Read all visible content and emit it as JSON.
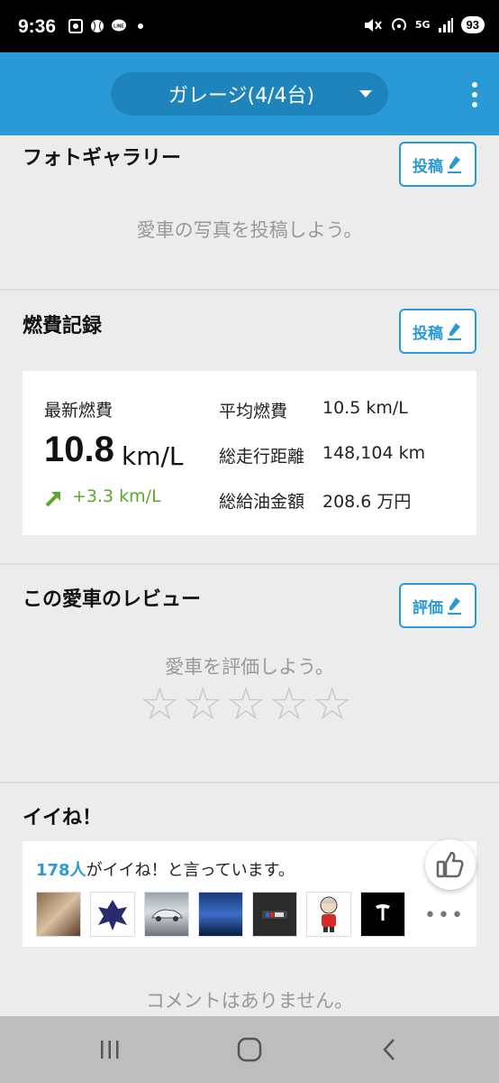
{
  "status": {
    "time": "9:36",
    "battery": "93",
    "network": "5G"
  },
  "app_bar": {
    "garage_label": "ガレージ(4/4台)"
  },
  "photo_gallery": {
    "title": "フォトギャラリー",
    "post_label": "投稿",
    "empty_text": "愛車の写真を投稿しよう。"
  },
  "fuel": {
    "title": "燃費記録",
    "post_label": "投稿",
    "latest_label": "最新燃費",
    "latest_value": "10.8",
    "latest_unit": "km/L",
    "diff": "+3.3 km/L",
    "avg_label": "平均燃費",
    "avg_value": "10.5 km/L",
    "distance_label": "総走行距離",
    "distance_value": "148,104 km",
    "cost_label": "総給油金額",
    "cost_value": "208.6 万円"
  },
  "review": {
    "title": "この愛車のレビュー",
    "rate_label": "評価",
    "empty_text": "愛車を評価しよう。",
    "stars": [
      "☆",
      "☆",
      "☆",
      "☆",
      "☆"
    ]
  },
  "likes": {
    "title": "イイね！",
    "count": "178人",
    "suffix": "がイイね！と言っています。",
    "more": "•••"
  },
  "comments": {
    "empty_text": "コメントはありません。"
  },
  "colors": {
    "accent": "#2a9ad6",
    "positive": "#5aa82a"
  }
}
